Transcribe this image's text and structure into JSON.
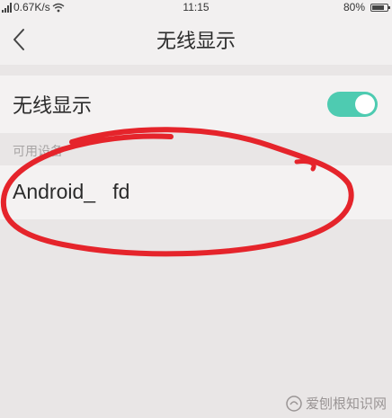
{
  "status_bar": {
    "network_speed": "0.67K/s",
    "time": "11:15",
    "battery": "80%",
    "battery_level": 0.8
  },
  "header": {
    "back_icon": "chevron-left-icon",
    "title": "无线显示"
  },
  "wireless_display": {
    "label": "无线显示",
    "toggle_on": true,
    "accent_color": "#4ecbb1"
  },
  "available_devices": {
    "section_title": "可用设备",
    "devices": [
      {
        "name": "Android_   fd"
      }
    ]
  },
  "annotation": {
    "color": "#e5242b",
    "shape": "hand-drawn-circle"
  },
  "watermark": {
    "text": "爱刨根知识网"
  }
}
